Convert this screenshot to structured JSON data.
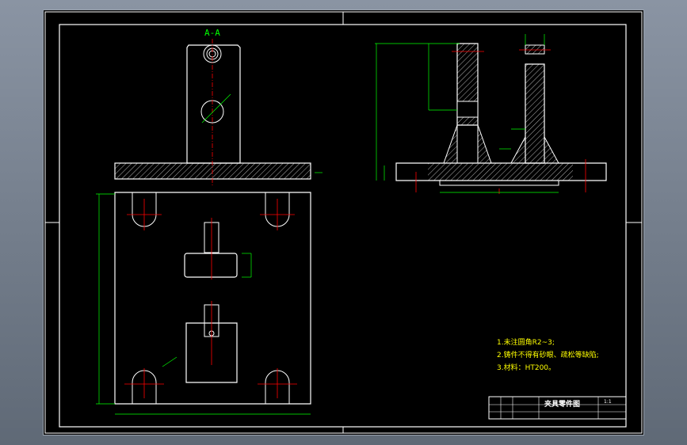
{
  "drawing": {
    "section_label": "A-A",
    "notes": [
      "1.未注圆角R2~3;",
      "2.铸件不得有砂眼、疏松等缺陷;",
      "3.材料：HT200。"
    ],
    "title_block": {
      "title": "夹具零件图",
      "scale": "1:1"
    },
    "colors": {
      "background": "#000000",
      "outline": "#ffffff",
      "hatch": "#ffffff",
      "centerline": "#ff0000",
      "dimension": "#00ff00",
      "note_text": "#ffff00"
    }
  }
}
